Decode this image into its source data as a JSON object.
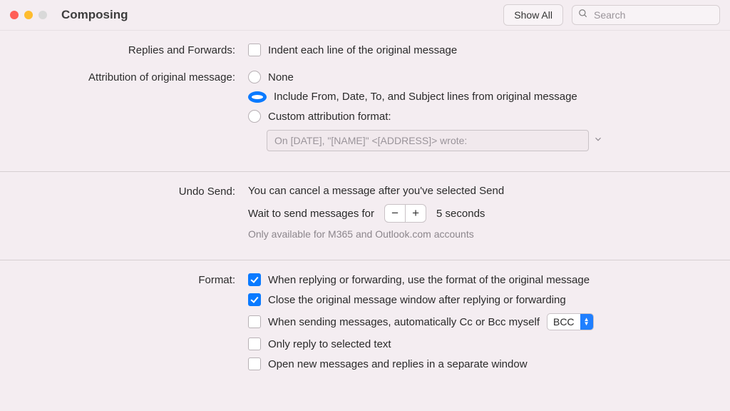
{
  "titlebar": {
    "title": "Composing",
    "show_all": "Show All",
    "search_placeholder": "Search"
  },
  "replies_forwards": {
    "label": "Replies and Forwards:",
    "indent": "Indent each line of the original message"
  },
  "attribution": {
    "label": "Attribution of original message:",
    "options": {
      "none": "None",
      "include": "Include From, Date, To, and Subject lines from original message",
      "custom": "Custom attribution format:"
    },
    "custom_placeholder": "On [DATE], \"[NAME]\" <[ADDRESS]> wrote:"
  },
  "undo_send": {
    "label": "Undo Send:",
    "description": "You can cancel a message after you've selected Send",
    "wait_prefix": "Wait to send messages for",
    "seconds_value": "5 seconds",
    "hint": "Only available for M365 and Outlook.com accounts"
  },
  "format": {
    "label": "Format:",
    "opts": {
      "use_original": "When replying or forwarding, use the format of the original message",
      "close_original": "Close the original message window after replying or forwarding",
      "auto_cc": "When sending messages, automatically Cc or Bcc myself",
      "only_selected": "Only reply to selected text",
      "separate_window": "Open new messages and replies in a separate window"
    },
    "bcc_option": "BCC"
  }
}
